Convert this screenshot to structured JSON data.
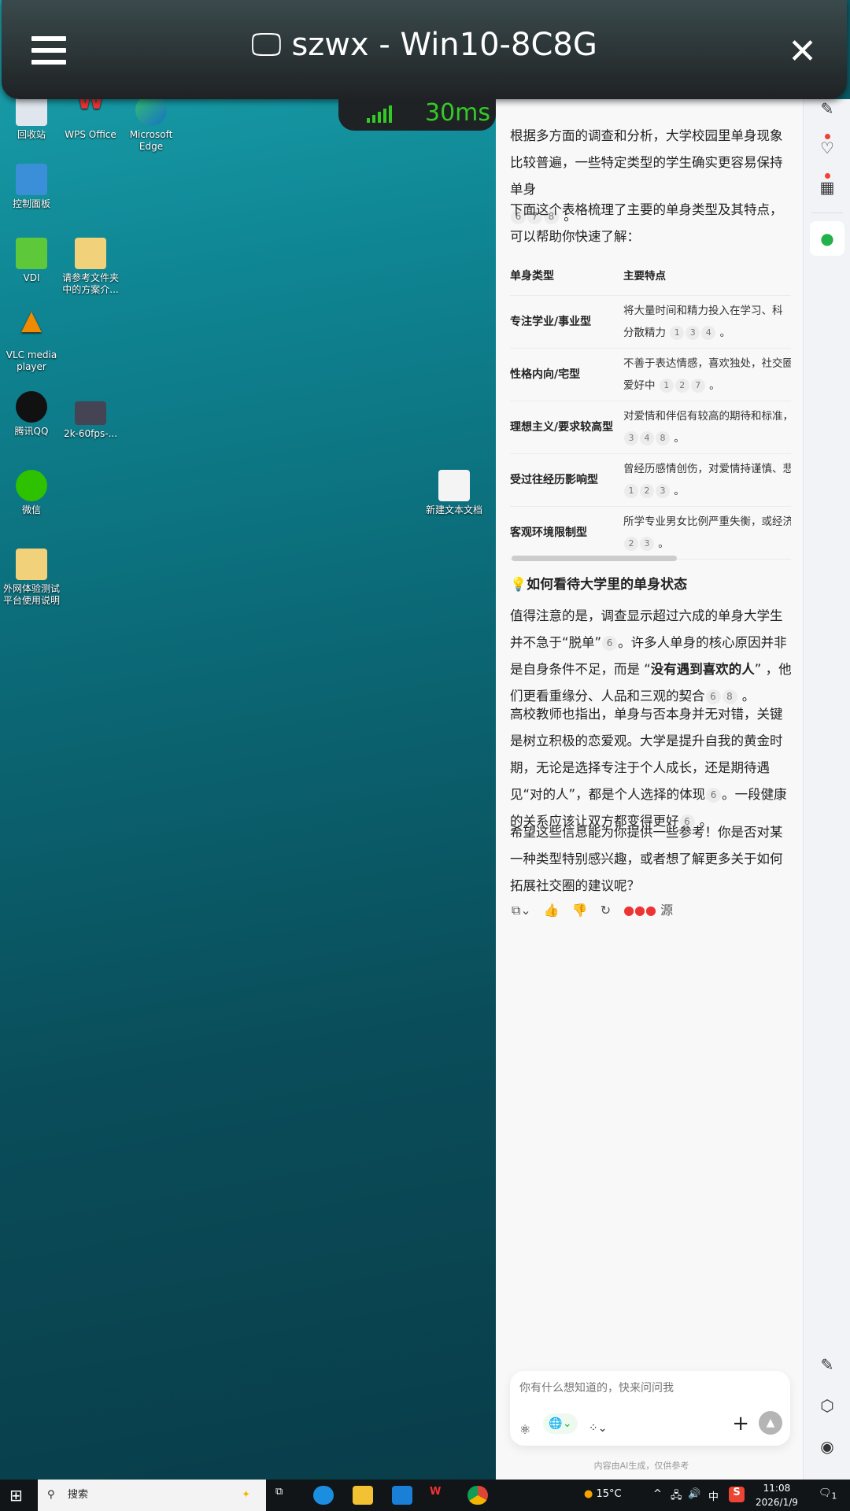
{
  "remote_bar": {
    "title": "szwx - Win10-8C8G",
    "latency": "30ms"
  },
  "desktop": {
    "icons": [
      "回收站",
      "WPS Office",
      "Microsoft Edge",
      "控制面板",
      "VDI",
      "请参考文件夹中的方案介...",
      "VLC media player",
      "腾讯QQ",
      "2k-60fps-...",
      "微信",
      "新建文本文档",
      "外网体验测试平台使用说明"
    ]
  },
  "chat": {
    "p1": "根据多方面的调查和分析，大学校园里单身现象比较普遍，一些特定类型的学生确实更容易保持单身",
    "p1_cites": [
      "6",
      "7",
      "8"
    ],
    "p2": "下面这个表格梳理了主要的单身类型及其特点，可以帮助你快速了解：",
    "table": {
      "headers": [
        "单身类型",
        "主要特点"
      ],
      "rows": [
        {
          "type": "专注学业/事业型",
          "l1": "将大量时间和精力投入在学习、科",
          "l2": "分散精力",
          "cites": [
            "1",
            "3",
            "4"
          ]
        },
        {
          "type": "性格内向/宅型",
          "l1": "不善于表达情感，喜欢独处，社交圈",
          "l2": "爱好中",
          "cites": [
            "1",
            "2",
            "7"
          ]
        },
        {
          "type": "理想主义/要求较高型",
          "l1": "对爱情和伴侣有较高的期待和标准，",
          "l2": "",
          "cites": [
            "3",
            "4",
            "8"
          ]
        },
        {
          "type": "受过往经历影响型",
          "l1": "曾经历感情创伤，对爱情持谨慎、悲",
          "l2": "",
          "cites": [
            "1",
            "2",
            "3"
          ]
        },
        {
          "type": "客观环境限制型",
          "l1": "所学专业男女比例严重失衡，或经济",
          "l2": "",
          "cites": [
            "2",
            "3"
          ]
        }
      ]
    },
    "h2": "如何看待大学里的单身状态",
    "p3a": "值得注意的是，调查显示超过六成的单身大学生并不急于“脱单”",
    "p3b": "。许多人单身的核心原因并非是自身条件不足，而是 “",
    "p3bold": "没有遇到喜欢的人",
    "p3c": "” ，他们更看重缘分、人品和三观的契合",
    "p4a": "高校教师也指出，单身与否本身并无对错，关键是树立积极的恋爱观。大学是提升自我的黄金时期，无论是选择专注于个人成长，还是期待遇见“对的人”，都是个人选择的体现",
    "p4b": "。一段健康的关系应该让双方都变得更好",
    "p5": "希望这些信息能为你提供一些参考！你是否对某一种类型特别感兴趣，或者想了解更多关于如何拓展社交圈的建议呢？",
    "sources_label": "源",
    "input_placeholder": "你有什么想知道的，快来问问我",
    "disclaimer": "内容由AI生成，仅供参考"
  },
  "taskbar": {
    "search": "搜索",
    "weather": "15°C",
    "ime": "中",
    "time": "11:08",
    "date": "2026/1/9",
    "notif_count": "1"
  }
}
